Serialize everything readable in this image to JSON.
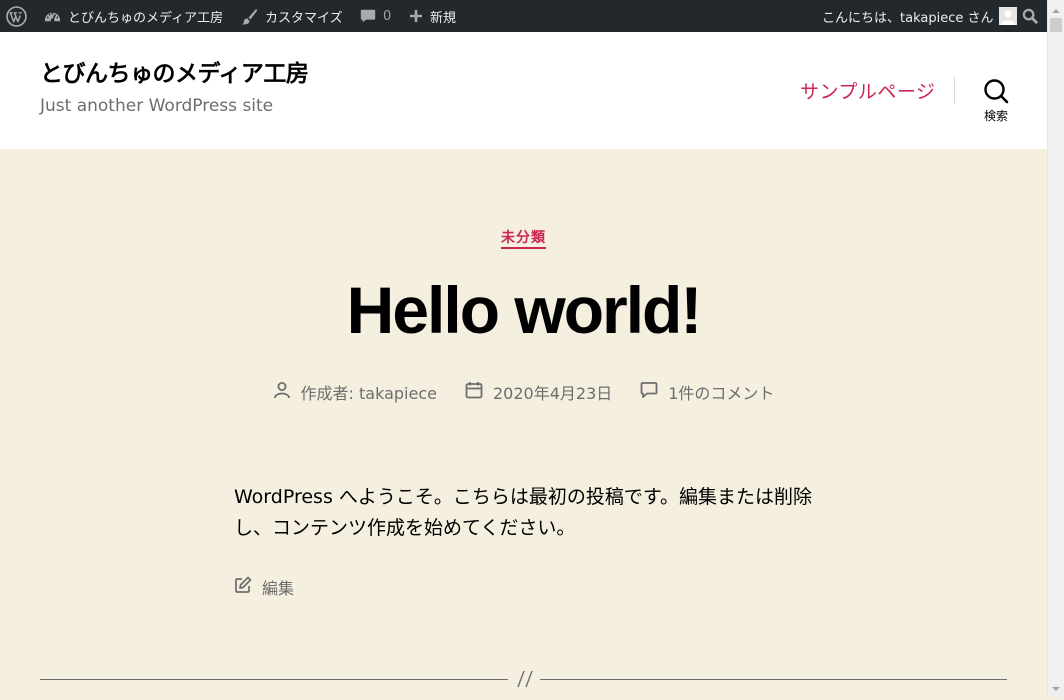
{
  "adminbar": {
    "site_name": "とびんちゅのメディア工房",
    "customize": "カスタマイズ",
    "comments_count": "0",
    "new_label": "新規",
    "greeting": "こんにちは、takapiece さん",
    "icons": [
      "wordpress-icon",
      "dashboard-icon",
      "brush-icon",
      "comment-icon",
      "plus-icon",
      "avatar",
      "search-icon"
    ]
  },
  "header": {
    "site_title": "とびんちゅのメディア工房",
    "site_description": "Just another WordPress site",
    "nav_item": "サンプルページ",
    "search_label": "検索"
  },
  "post": {
    "category": "未分類",
    "title": "Hello world!",
    "author": "作成者: takapiece",
    "date": "2020年4月23日",
    "comments": "1件のコメント",
    "content": "WordPress へようこそ。こちらは最初の投稿です。編集または削除し、コンテンツ作成を始めてください。",
    "edit": "編集"
  },
  "colors": {
    "accent": "#cd2653",
    "background": "#f5efe0",
    "adminbar": "#23282d",
    "meta_text": "#6d6d6d"
  }
}
